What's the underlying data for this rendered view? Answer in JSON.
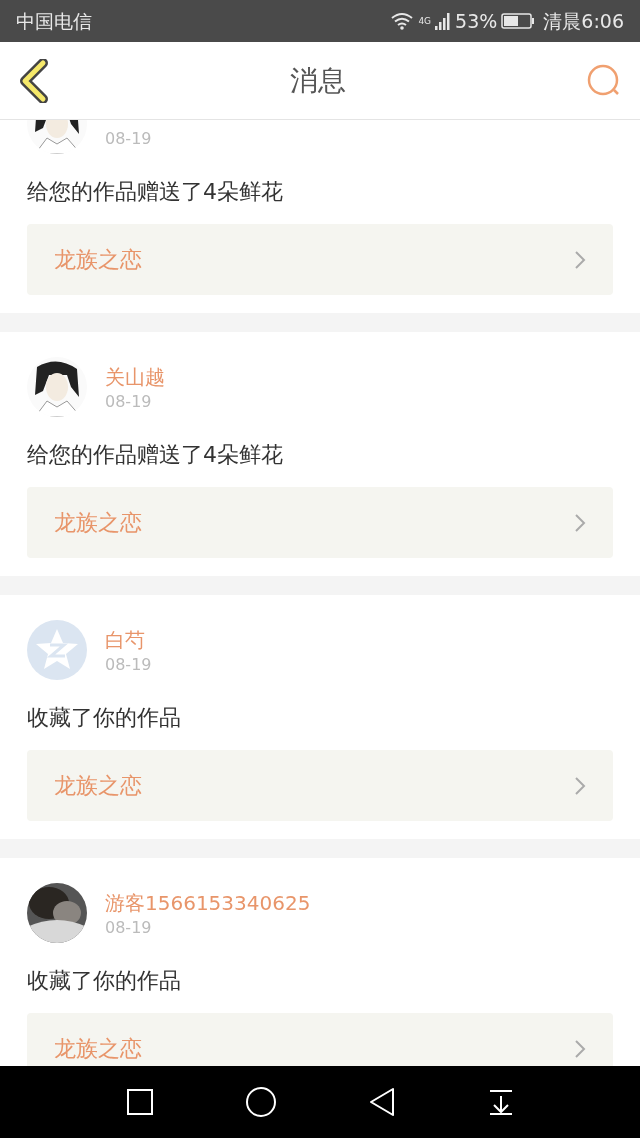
{
  "status_bar": {
    "carrier": "中国电信",
    "network": "4G",
    "battery": "53%",
    "time": "清晨6:06"
  },
  "header": {
    "title": "消息"
  },
  "messages": [
    {
      "kind": "picture",
      "date": "08-19",
      "text": "给您的作品赠送了4朵鲜花",
      "work": "龙族之恋"
    },
    {
      "kind": "picture",
      "name": "关山越",
      "date": "08-19",
      "text": "给您的作品赠送了4朵鲜花",
      "work": "龙族之恋"
    },
    {
      "kind": "default",
      "name": "白芍",
      "date": "08-19",
      "text": "收藏了你的作品",
      "work": "龙族之恋"
    },
    {
      "name": "游客1566153340625",
      "date": "08-19",
      "text": "收藏了你的作品",
      "work": "龙族之恋"
    }
  ]
}
